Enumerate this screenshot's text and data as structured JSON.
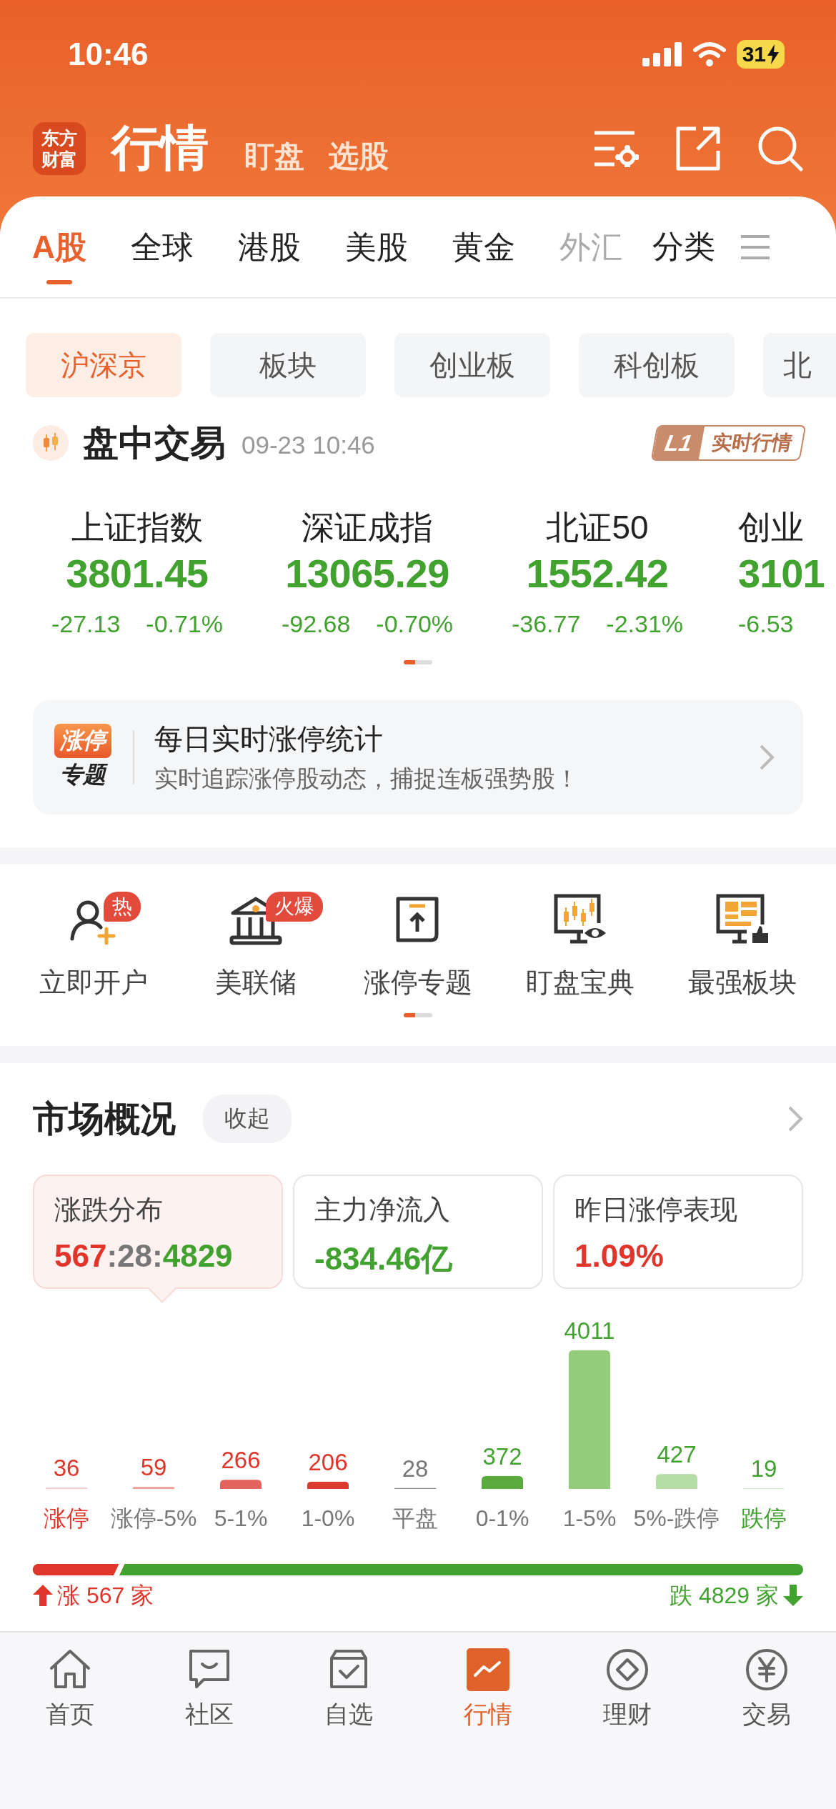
{
  "status_bar": {
    "time": "10:46",
    "battery": "31"
  },
  "header": {
    "logo": "东方财富",
    "title": "行情",
    "links": [
      {
        "label": "盯盘"
      },
      {
        "label": "选股"
      }
    ]
  },
  "tabs": [
    {
      "label": "A股",
      "selected": true,
      "faded": false
    },
    {
      "label": "全球",
      "selected": false,
      "faded": false
    },
    {
      "label": "港股",
      "selected": false,
      "faded": false
    },
    {
      "label": "美股",
      "selected": false,
      "faded": false
    },
    {
      "label": "黄金",
      "selected": false,
      "faded": false
    },
    {
      "label": "外汇",
      "selected": false,
      "faded": true
    }
  ],
  "category_button": "分类",
  "chips": [
    {
      "label": "沪深京",
      "selected": true
    },
    {
      "label": "板块",
      "selected": false
    },
    {
      "label": "创业板",
      "selected": false
    },
    {
      "label": "科创板",
      "selected": false
    },
    {
      "label": "北",
      "selected": false
    }
  ],
  "session": {
    "title": "盘中交易",
    "time": "09-23 10:46",
    "badge": {
      "level": "L1",
      "text": "实时行情"
    }
  },
  "indices": [
    {
      "name": "上证指数",
      "value": "3801.45",
      "change": "-27.13",
      "percent": "-0.71%",
      "color": "#42a22f"
    },
    {
      "name": "深证成指",
      "value": "13065.29",
      "change": "-92.68",
      "percent": "-0.70%",
      "color": "#42a22f"
    },
    {
      "name": "北证50",
      "value": "1552.42",
      "change": "-36.77",
      "percent": "-2.31%",
      "color": "#42a22f"
    },
    {
      "name": "创业",
      "value": "3101",
      "change": "-6.53",
      "color": "#42a22f"
    }
  ],
  "promo": {
    "icon_top": "涨停",
    "icon_bottom": "专题",
    "title": "每日实时涨停统计",
    "subtitle": "实时追踪涨停股动态，捕捉连板强势股！"
  },
  "shortcuts": [
    {
      "label": "立即开户",
      "badge": "热"
    },
    {
      "label": "美联储",
      "badge": "火爆"
    },
    {
      "label": "涨停专题"
    },
    {
      "label": "盯盘宝典"
    },
    {
      "label": "最强板块"
    }
  ],
  "overview": {
    "title": "市场概况",
    "collapse": "收起",
    "cards": [
      {
        "title": "涨跌分布",
        "selected": true,
        "parts": [
          {
            "text": "567",
            "color": "#e0352b"
          },
          {
            "text": ":",
            "color": "#777777"
          },
          {
            "text": "28",
            "color": "#777777"
          },
          {
            "text": ":",
            "color": "#777777"
          },
          {
            "text": "4829",
            "color": "#42a22f"
          }
        ]
      },
      {
        "title": "主力净流入",
        "selected": false,
        "parts": [
          {
            "text": "-834.46亿",
            "color": "#42a22f"
          }
        ]
      },
      {
        "title": "昨日涨停表现",
        "selected": false,
        "parts": [
          {
            "text": "1.09%",
            "color": "#e0352b"
          }
        ]
      }
    ],
    "distribution": {
      "chart_data": {
        "type": "bar",
        "categories": [
          "涨停",
          "涨停-5%",
          "5-1%",
          "1-0%",
          "平盘",
          "0-1%",
          "1-5%",
          "5%-跌停",
          "跌停"
        ],
        "series": [
          {
            "values": [
              36,
              59,
              266,
              206,
              28,
              372,
              4011,
              427,
              19
            ]
          }
        ],
        "data_labels": true
      },
      "bars": [
        {
          "color": "#f6c4c4"
        },
        {
          "color": "#ee9a96"
        },
        {
          "color": "#e2625c"
        },
        {
          "color": "#dc3a2e"
        },
        {
          "color": "#8e8e8e"
        },
        {
          "color": "#5aaa3e"
        },
        {
          "color": "#93cc7a"
        },
        {
          "color": "#b6dca5"
        },
        {
          "color": "#d9edd0"
        }
      ],
      "data_label_styles": [
        {
          "color": "#e0352b"
        },
        {
          "color": "#e0352b"
        },
        {
          "color": "#e0352b"
        },
        {
          "color": "#e0352b"
        },
        {
          "color": "#777777"
        },
        {
          "color": "#42a22f"
        },
        {
          "color": "#42a22f"
        },
        {
          "color": "#42a22f"
        },
        {
          "color": "#42a22f"
        }
      ],
      "category_styles": [
        {
          "color": "#e0352b"
        },
        {
          "color": "#777777"
        },
        {
          "color": "#777777"
        },
        {
          "color": "#777777"
        },
        {
          "color": "#777777"
        },
        {
          "color": "#777777"
        },
        {
          "color": "#777777"
        },
        {
          "color": "#777777"
        },
        {
          "color": "#42a22f"
        }
      ],
      "ratio": {
        "level": 0.11
      },
      "up_text": "涨 567 家",
      "down_text": "跌 4829 家"
    }
  },
  "bottom_nav": [
    {
      "label": "首页",
      "selected": false
    },
    {
      "label": "社区",
      "selected": false
    },
    {
      "label": "自选",
      "selected": false
    },
    {
      "label": "行情",
      "selected": true
    },
    {
      "label": "理财",
      "selected": false
    },
    {
      "label": "交易",
      "selected": false
    }
  ]
}
